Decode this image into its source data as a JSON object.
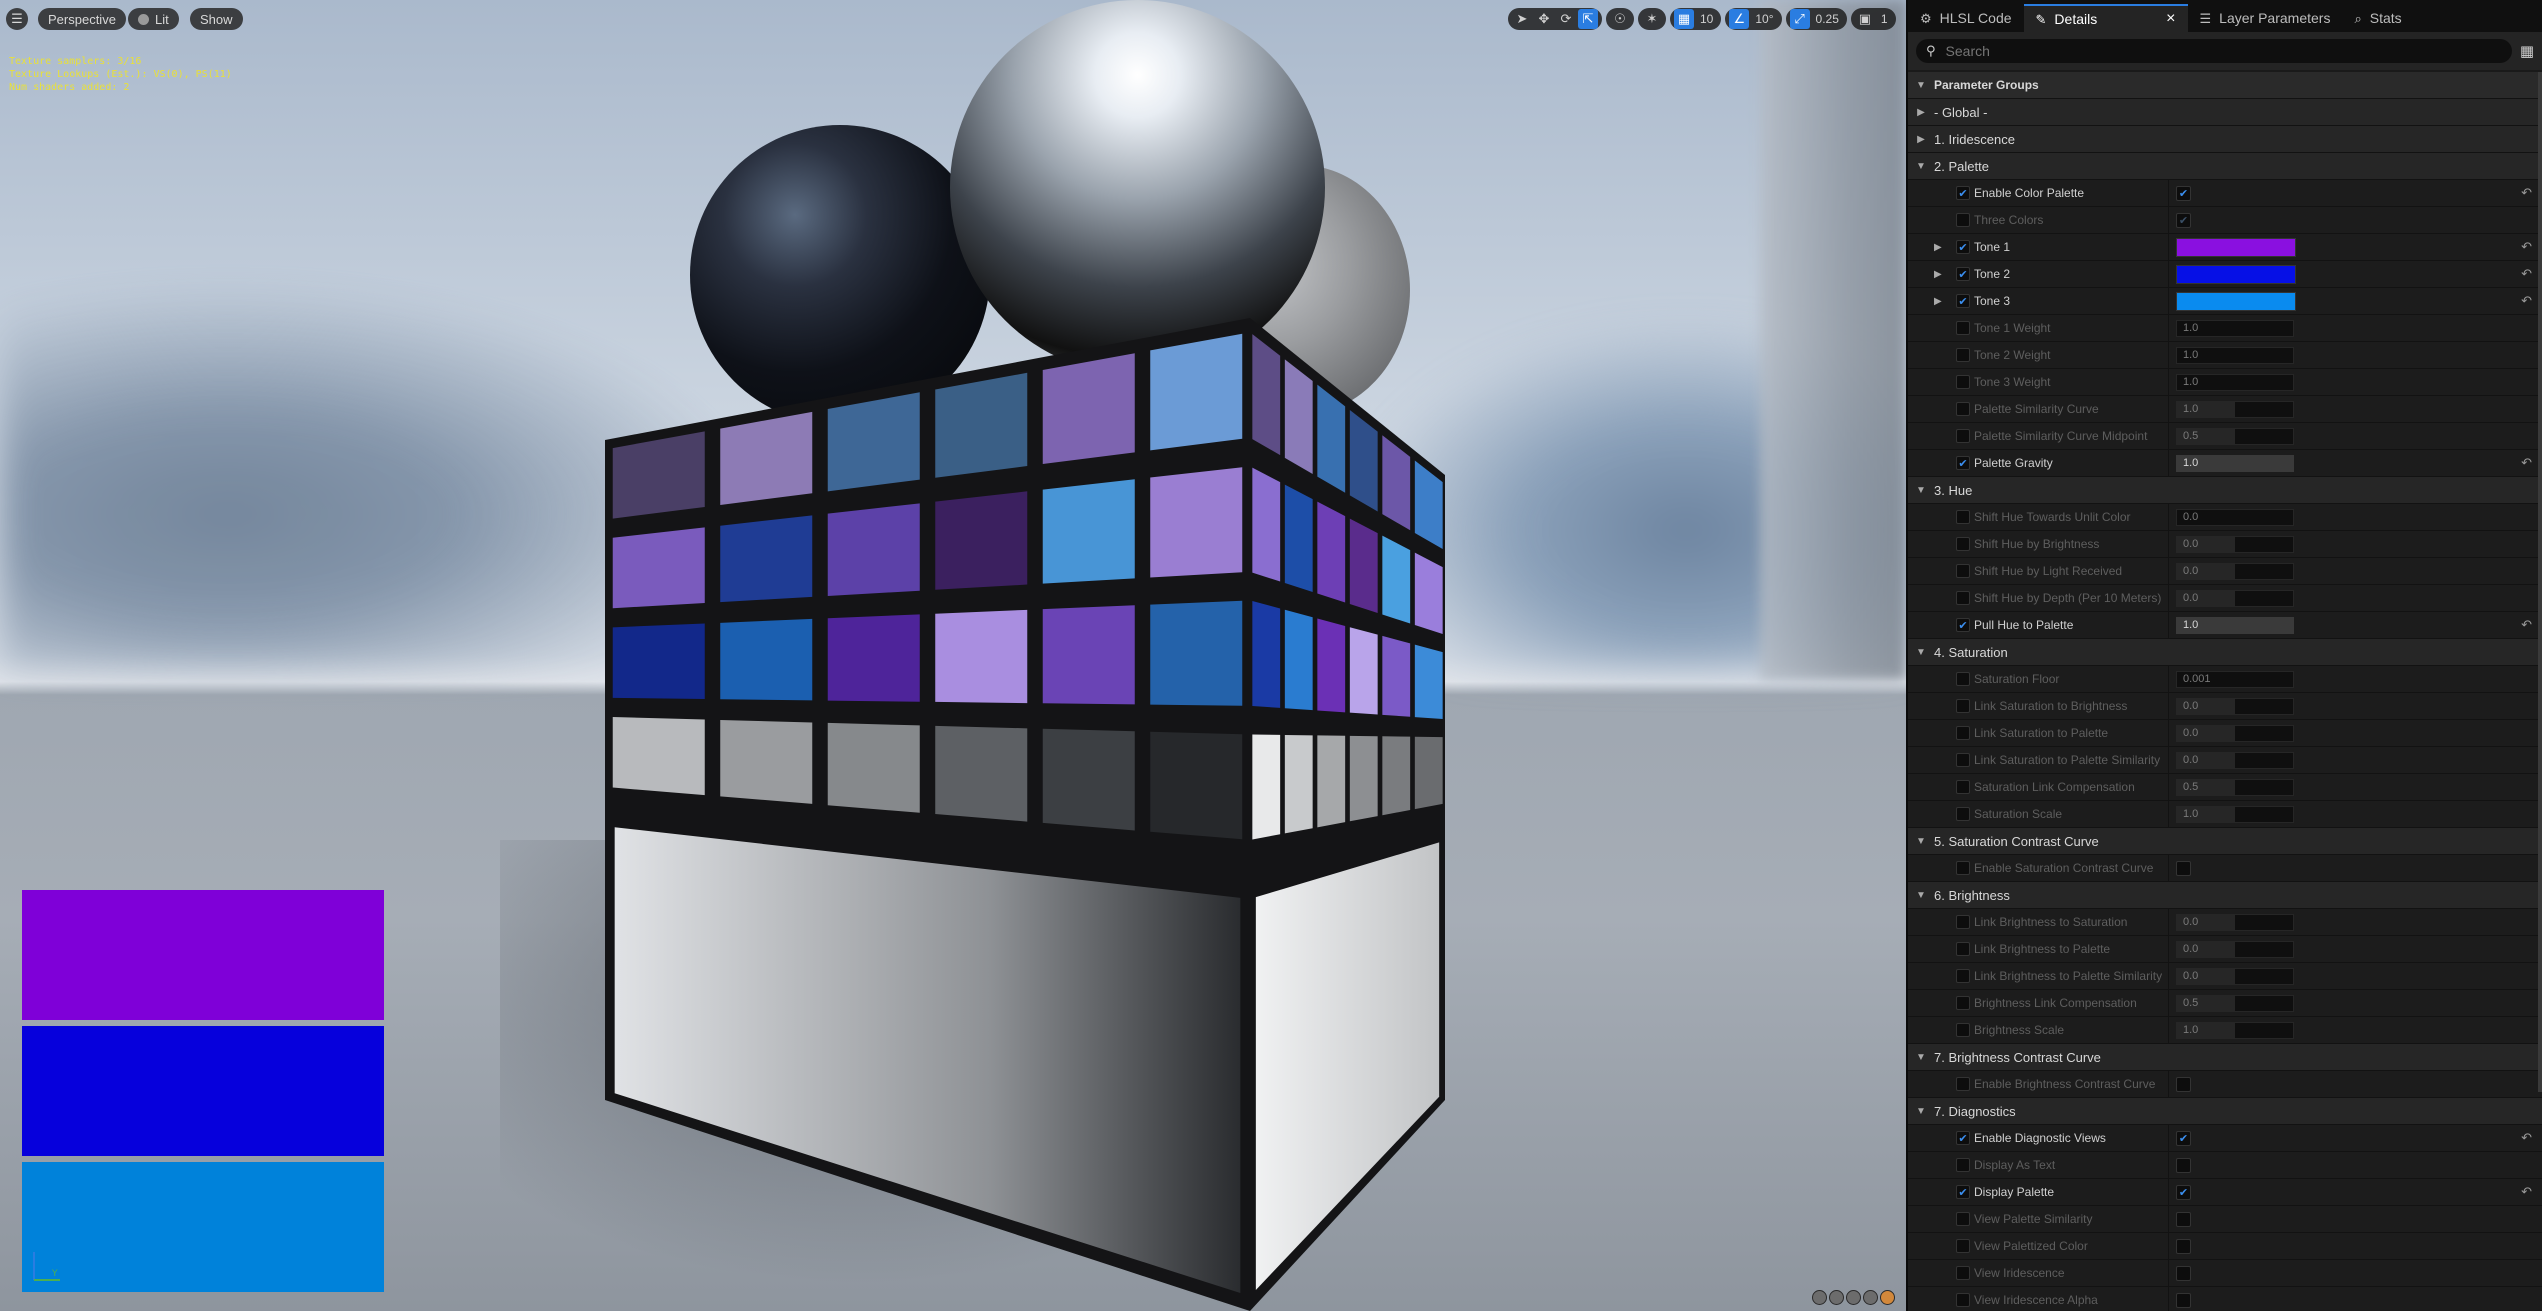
{
  "viewport": {
    "perspective_label": "Perspective",
    "lit_label": "Lit",
    "show_label": "Show",
    "stats_lines": [
      "Texture samplers: 3/16",
      "Texture Lookups (Est.): VS(0), PS(11)",
      "Num shaders added: 2"
    ],
    "toolbar": {
      "grid_value": "10",
      "angle_value": "10°",
      "scale_value": "0.25",
      "camera_speed": "1"
    },
    "swatch_colors": [
      "#7f00d8",
      "#0600dc",
      "#0082da"
    ],
    "axis_label": "Y"
  },
  "panel": {
    "tabs": [
      {
        "label": "HLSL Code",
        "icon": "code-icon"
      },
      {
        "label": "Details",
        "icon": "pencil-icon",
        "active": true
      },
      {
        "label": "Layer Parameters",
        "icon": "layers-icon"
      },
      {
        "label": "Stats",
        "icon": "stats-icon"
      }
    ],
    "search_placeholder": "Search",
    "header": "Parameter Groups",
    "groups": [
      {
        "label": "- Global -",
        "expanded": false
      },
      {
        "label": "1. Iridescence",
        "expanded": false
      },
      {
        "label": "2. Palette",
        "expanded": true,
        "params": [
          {
            "label": "Enable Color Palette",
            "on": true,
            "type": "bool",
            "value": true,
            "reset": true
          },
          {
            "label": "Three Colors",
            "on": false,
            "type": "bool",
            "value": true,
            "dim": true
          },
          {
            "label": "Tone 1",
            "on": true,
            "type": "color",
            "color": "#8a10e0",
            "expand": true,
            "reset": true
          },
          {
            "label": "Tone 2",
            "on": true,
            "type": "color",
            "color": "#0610e6",
            "expand": true,
            "reset": true
          },
          {
            "label": "Tone 3",
            "on": true,
            "type": "color",
            "color": "#0a8bef",
            "expand": true,
            "reset": true
          },
          {
            "label": "Tone 1 Weight",
            "on": false,
            "type": "num",
            "value": "1.0",
            "fill": 0
          },
          {
            "label": "Tone 2 Weight",
            "on": false,
            "type": "num",
            "value": "1.0",
            "fill": 0
          },
          {
            "label": "Tone 3 Weight",
            "on": false,
            "type": "num",
            "value": "1.0",
            "fill": 0
          },
          {
            "label": "Palette Similarity Curve",
            "on": false,
            "type": "num",
            "value": "1.0",
            "fill": 0.5
          },
          {
            "label": "Palette Similarity Curve Midpoint",
            "on": false,
            "type": "num",
            "value": "0.5",
            "fill": 0.5
          },
          {
            "label": "Palette Gravity",
            "on": true,
            "type": "num",
            "value": "1.0",
            "fill": 1.0,
            "reset": true
          }
        ]
      },
      {
        "label": "3. Hue",
        "expanded": true,
        "params": [
          {
            "label": "Shift Hue Towards Unlit Color",
            "on": false,
            "type": "num",
            "value": "0.0",
            "fill": 0
          },
          {
            "label": "Shift Hue by Brightness",
            "on": false,
            "type": "num",
            "value": "0.0",
            "fill": 0.5
          },
          {
            "label": "Shift Hue by Light Received",
            "on": false,
            "type": "num",
            "value": "0.0",
            "fill": 0.5
          },
          {
            "label": "Shift Hue by Depth (Per 10 Meters)",
            "on": false,
            "type": "num",
            "value": "0.0",
            "fill": 0.5
          },
          {
            "label": "Pull Hue to Palette",
            "on": true,
            "type": "num",
            "value": "1.0",
            "fill": 1.0,
            "reset": true
          }
        ]
      },
      {
        "label": "4. Saturation",
        "expanded": true,
        "params": [
          {
            "label": "Saturation Floor",
            "on": false,
            "type": "num",
            "value": "0.001",
            "fill": 0
          },
          {
            "label": "Link Saturation to Brightness",
            "on": false,
            "type": "num",
            "value": "0.0",
            "fill": 0.5
          },
          {
            "label": "Link Saturation to Palette",
            "on": false,
            "type": "num",
            "value": "0.0",
            "fill": 0.5
          },
          {
            "label": "Link Saturation to Palette Similarity",
            "on": false,
            "type": "num",
            "value": "0.0",
            "fill": 0.5
          },
          {
            "label": "Saturation Link Compensation",
            "on": false,
            "type": "num",
            "value": "0.5",
            "fill": 0.5
          },
          {
            "label": "Saturation Scale",
            "on": false,
            "type": "num",
            "value": "1.0",
            "fill": 0.5
          }
        ]
      },
      {
        "label": "5. Saturation Contrast Curve",
        "expanded": true,
        "params": [
          {
            "label": "Enable Saturation Contrast Curve",
            "on": false,
            "type": "bool",
            "value": false
          }
        ]
      },
      {
        "label": "6. Brightness",
        "expanded": true,
        "params": [
          {
            "label": "Link Brightness to Saturation",
            "on": false,
            "type": "num",
            "value": "0.0",
            "fill": 0.5
          },
          {
            "label": "Link Brightness to Palette",
            "on": false,
            "type": "num",
            "value": "0.0",
            "fill": 0.5
          },
          {
            "label": "Link Brightness to Palette Similarity",
            "on": false,
            "type": "num",
            "value": "0.0",
            "fill": 0.5
          },
          {
            "label": "Brightness Link Compensation",
            "on": false,
            "type": "num",
            "value": "0.5",
            "fill": 0.5
          },
          {
            "label": "Brightness Scale",
            "on": false,
            "type": "num",
            "value": "1.0",
            "fill": 0.5
          }
        ]
      },
      {
        "label": "7. Brightness Contrast Curve",
        "expanded": true,
        "params": [
          {
            "label": "Enable Brightness Contrast Curve",
            "on": false,
            "type": "bool",
            "value": false
          }
        ]
      },
      {
        "label": "7. Diagnostics",
        "expanded": true,
        "params": [
          {
            "label": "Enable Diagnostic Views",
            "on": true,
            "type": "bool",
            "value": true,
            "reset": true
          },
          {
            "label": "Display As Text",
            "on": false,
            "type": "bool",
            "value": false
          },
          {
            "label": "Display Palette",
            "on": true,
            "type": "bool",
            "value": true,
            "reset": true
          },
          {
            "label": "View Palette Similarity",
            "on": false,
            "type": "bool",
            "value": false
          },
          {
            "label": "View Palettized Color",
            "on": false,
            "type": "bool",
            "value": false
          },
          {
            "label": "View Iridescence",
            "on": false,
            "type": "bool",
            "value": false
          },
          {
            "label": "View Iridescence Alpha",
            "on": false,
            "type": "bool",
            "value": false
          }
        ]
      }
    ]
  }
}
